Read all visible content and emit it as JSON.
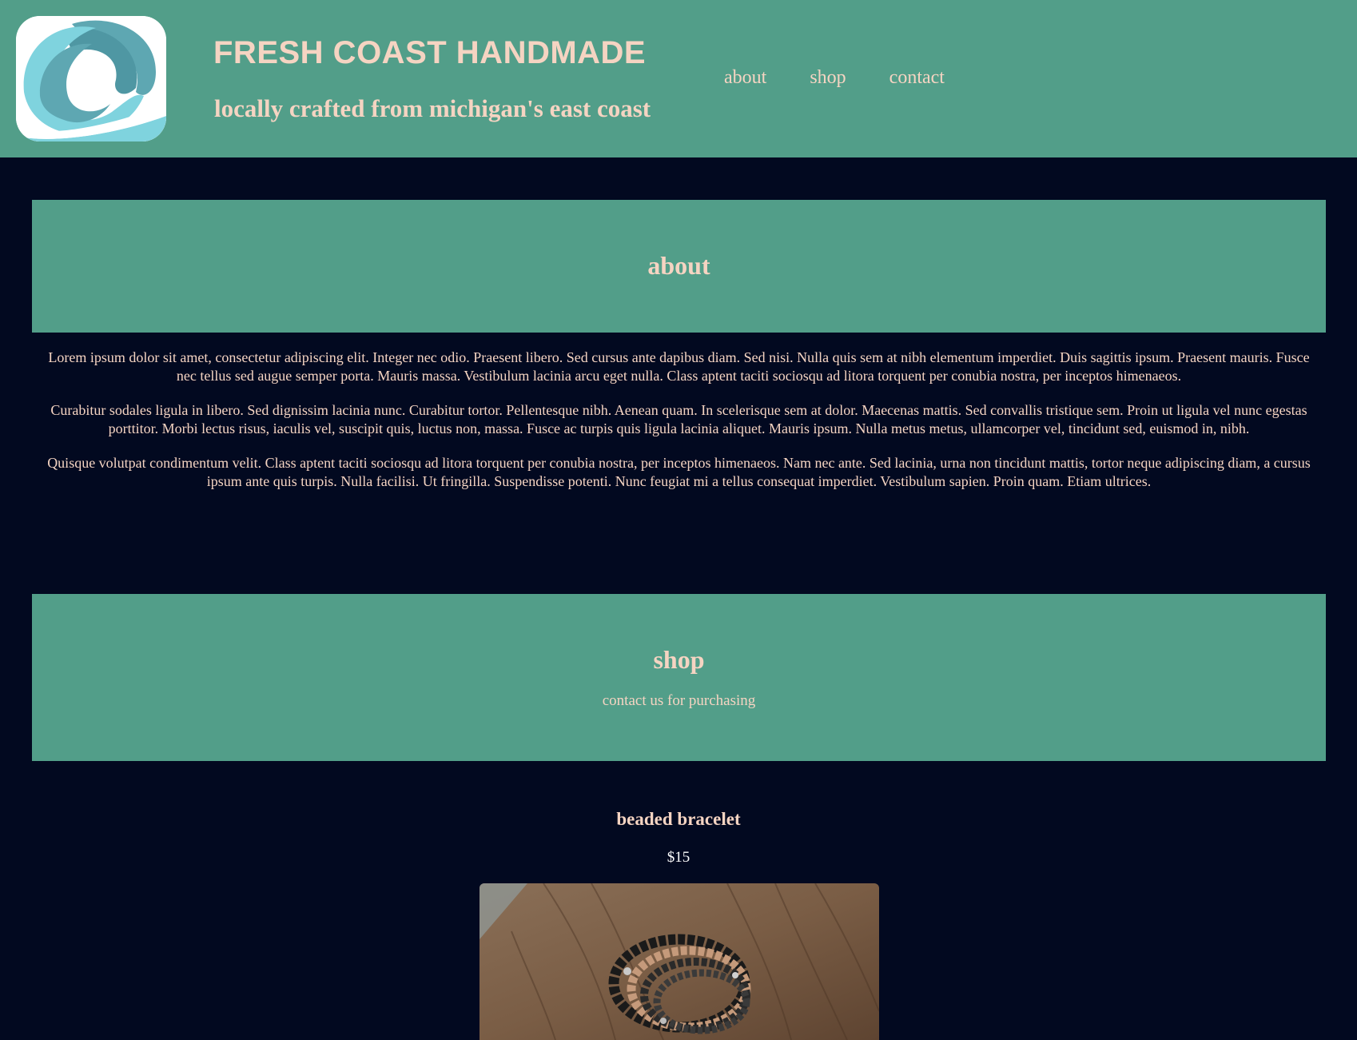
{
  "header": {
    "brand_title": "FRESH COAST HANDMADE",
    "tagline": "locally crafted from michigan's east coast",
    "logo_icon": "wave-logo-icon",
    "nav": [
      {
        "label": "about"
      },
      {
        "label": "shop"
      },
      {
        "label": "contact"
      }
    ]
  },
  "about": {
    "heading": "about",
    "paragraphs": [
      "Lorem ipsum dolor sit amet, consectetur adipiscing elit. Integer nec odio. Praesent libero. Sed cursus ante dapibus diam. Sed nisi. Nulla quis sem at nibh elementum imperdiet. Duis sagittis ipsum. Praesent mauris. Fusce nec tellus sed augue semper porta. Mauris massa. Vestibulum lacinia arcu eget nulla. Class aptent taciti sociosqu ad litora torquent per conubia nostra, per inceptos himenaeos.",
      "Curabitur sodales ligula in libero. Sed dignissim lacinia nunc. Curabitur tortor. Pellentesque nibh. Aenean quam. In scelerisque sem at dolor. Maecenas mattis. Sed convallis tristique sem. Proin ut ligula vel nunc egestas porttitor. Morbi lectus risus, iaculis vel, suscipit quis, luctus non, massa. Fusce ac turpis quis ligula lacinia aliquet. Mauris ipsum. Nulla metus metus, ullamcorper vel, tincidunt sed, euismod in, nibh.",
      "Quisque volutpat condimentum velit. Class aptent taciti sociosqu ad litora torquent per conubia nostra, per inceptos himenaeos. Nam nec ante. Sed lacinia, urna non tincidunt mattis, tortor neque adipiscing diam, a cursus ipsum ante quis turpis. Nulla facilisi. Ut fringilla. Suspendisse potenti. Nunc feugiat mi a tellus consequat imperdiet. Vestibulum sapien. Proin quam. Etiam ultrices."
    ]
  },
  "shop": {
    "heading": "shop",
    "subtitle": "contact us for purchasing",
    "products": [
      {
        "title": "beaded bracelet",
        "price": "$15",
        "image_icon": "beaded-bracelet-photo"
      }
    ]
  },
  "colors": {
    "header_bg": "#529e89",
    "page_bg": "#020920",
    "text": "#f5d4c2"
  }
}
